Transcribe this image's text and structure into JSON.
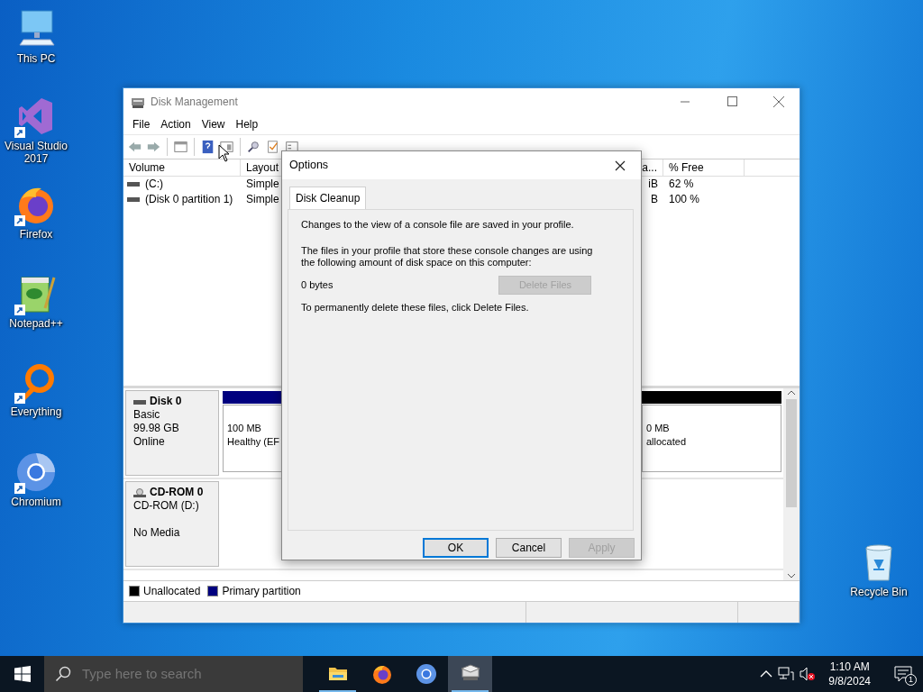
{
  "desktop_icons": [
    {
      "label": "This PC",
      "kind": "pc",
      "shortcut": false
    },
    {
      "label": "Visual Studio 2017",
      "kind": "vs",
      "shortcut": true
    },
    {
      "label": "Firefox",
      "kind": "firefox",
      "shortcut": true
    },
    {
      "label": "Notepad++",
      "kind": "notepad",
      "shortcut": true
    },
    {
      "label": "Everything",
      "kind": "everything",
      "shortcut": true
    },
    {
      "label": "Chromium",
      "kind": "chromium",
      "shortcut": true
    },
    {
      "label": "Recycle Bin",
      "kind": "recycle",
      "shortcut": false
    }
  ],
  "window": {
    "title": "Disk Management",
    "menu": [
      "File",
      "Action",
      "View",
      "Help"
    ],
    "volume_table": {
      "columns": [
        "Volume",
        "Layout",
        "a...",
        "% Free"
      ],
      "rows": [
        [
          "(C:)",
          "Simple",
          "iB",
          "62 %"
        ],
        [
          "(Disk 0 partition 1)",
          "Simple",
          "B",
          "100 %"
        ]
      ]
    },
    "disks": [
      {
        "kind": "disk",
        "name": "Disk 0",
        "lines": [
          "Basic",
          "99.98 GB",
          "Online"
        ],
        "partitions": [
          {
            "color": "#00007f",
            "size": "100 MB",
            "status": "Healthy (EF"
          },
          {
            "color": "#000000",
            "size": "0 MB",
            "status": "allocated"
          }
        ]
      },
      {
        "kind": "cdrom",
        "name": "CD-ROM 0",
        "lines": [
          "CD-ROM (D:)",
          "No Media"
        ]
      }
    ],
    "legend": [
      {
        "label": "Unallocated",
        "color": "#000000"
      },
      {
        "label": "Primary partition",
        "color": "#00007f"
      }
    ]
  },
  "dialog": {
    "title": "Options",
    "tabs": [
      {
        "label": "Disk Cleanup",
        "selected": true
      }
    ],
    "intro": "Changes to the view of a console file are saved in your profile.",
    "usage": "The files in your profile that store these console changes are using the following amount of disk space on this computer:",
    "size": "0 bytes",
    "delete_button": {
      "label": "Delete Files",
      "disabled": true
    },
    "note": "To permanently delete these files, click Delete Files.",
    "buttons": [
      {
        "label": "OK",
        "disabled": false,
        "default": true
      },
      {
        "label": "Cancel",
        "disabled": false,
        "default": false
      },
      {
        "label": "Apply",
        "disabled": true,
        "default": false
      }
    ]
  },
  "taskbar": {
    "search_placeholder": "Type here to search",
    "apps": [
      {
        "kind": "explorer",
        "active": false,
        "running": true
      },
      {
        "kind": "firefox",
        "active": false,
        "running": false
      },
      {
        "kind": "chromium",
        "active": false,
        "running": false
      },
      {
        "kind": "diskmgmt",
        "active": true,
        "running": true
      }
    ],
    "time": "1:10 AM",
    "date": "9/8/2024",
    "notifications": "1"
  }
}
